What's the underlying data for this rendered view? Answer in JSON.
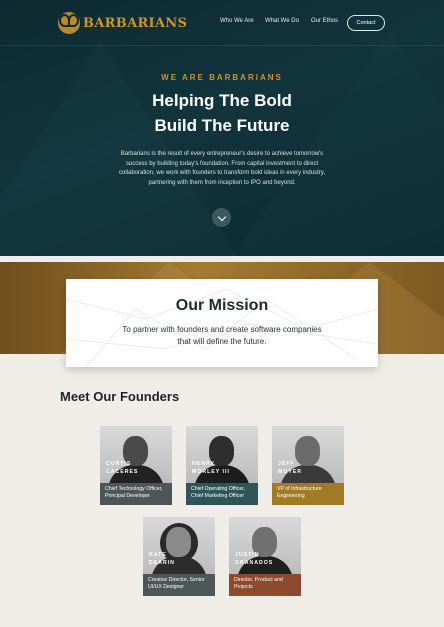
{
  "brand": {
    "name": "BARBARIANS",
    "accent": "#c8962e"
  },
  "nav": {
    "links": [
      "Who We Are",
      "What We Do",
      "Our Ethos"
    ],
    "cta": "Contact"
  },
  "hero": {
    "eyebrow": "WE ARE BARBARIANS",
    "title_line1": "Helping The Bold",
    "title_line2": "Build The Future",
    "lead": "Barbarians is the result of every entrepreneur's desire to achieve tomorrow's success by building today's foundation. From capital investment to direct collaboration, we work with founders to transform bold ideas in every industry, partnering with them from inception to IPO and beyond.",
    "scroll_icon": "chevron-down-icon"
  },
  "mission": {
    "title_plain": "Our ",
    "title_bold": "Mission",
    "text": "To partner with founders and create software companies that will define the future."
  },
  "founders": {
    "title_plain": "Meet Our ",
    "title_bold": "Founders",
    "people": [
      {
        "name_line1": "CURTIS",
        "name_line2": "CACERES",
        "role": "Chief Technology Officer, Principal Developer"
      },
      {
        "name_line1": "HENRY",
        "name_line2": "MORLEY III",
        "role": "Chief Operating Officer, Chief Marketing Officer"
      },
      {
        "name_line1": "JEFF",
        "name_line2": "MOYER",
        "role": "VP of Infrastructure Engineering"
      },
      {
        "name_line1": "KATE",
        "name_line2": "DEARIN",
        "role": "Creative Director, Senior UI/UX Designer"
      },
      {
        "name_line1": "JUSTIN",
        "name_line2": "GRANADOS",
        "role": "Director, Product and Projects"
      }
    ]
  }
}
